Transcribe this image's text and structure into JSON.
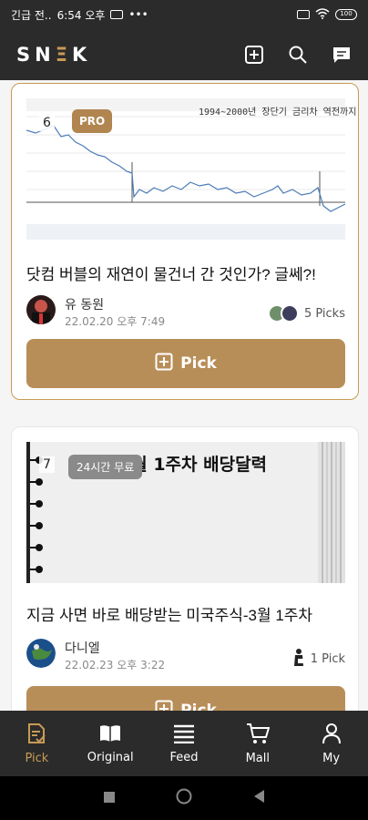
{
  "status_bar": {
    "carrier_text": "긴급 전..",
    "time": "6:54 오후",
    "more": "•••",
    "battery": "100"
  },
  "app": {
    "logo": {
      "left": "SN",
      "accent": "Ξ",
      "right": "K"
    }
  },
  "cards": [
    {
      "rank": "6",
      "badge": "PRO",
      "thumbnail_caption": "1994~2000년 장단기 금리차 역전까지",
      "title": "닷컴 버블의 재연이 물건너 간 것인가? 글쎄?!",
      "author": "유 동원",
      "date": "22.02.20 오후 7:49",
      "picks": "5 Picks",
      "button_label": "Pick"
    },
    {
      "rank": "7",
      "badge": "24시간 무료",
      "thumbnail_caption": "3월 1주차 배당달력",
      "title": "지금 사면 바로 배당받는 미국주식-3월 1주차",
      "author": "다니엘",
      "date": "22.02.23 오후 3:22",
      "picks": "1 Pick",
      "button_label": "Pick"
    }
  ],
  "bottom_nav": [
    {
      "label": "Pick",
      "icon": "pick-document-icon",
      "active": true
    },
    {
      "label": "Original",
      "icon": "book-icon",
      "active": false
    },
    {
      "label": "Feed",
      "icon": "feed-list-icon",
      "active": false
    },
    {
      "label": "Mall",
      "icon": "cart-icon",
      "active": false
    },
    {
      "label": "My",
      "icon": "person-icon",
      "active": false
    }
  ],
  "colors": {
    "accent": "#c89a55",
    "button": "#b88e58",
    "bar": "#2b2b2b"
  }
}
